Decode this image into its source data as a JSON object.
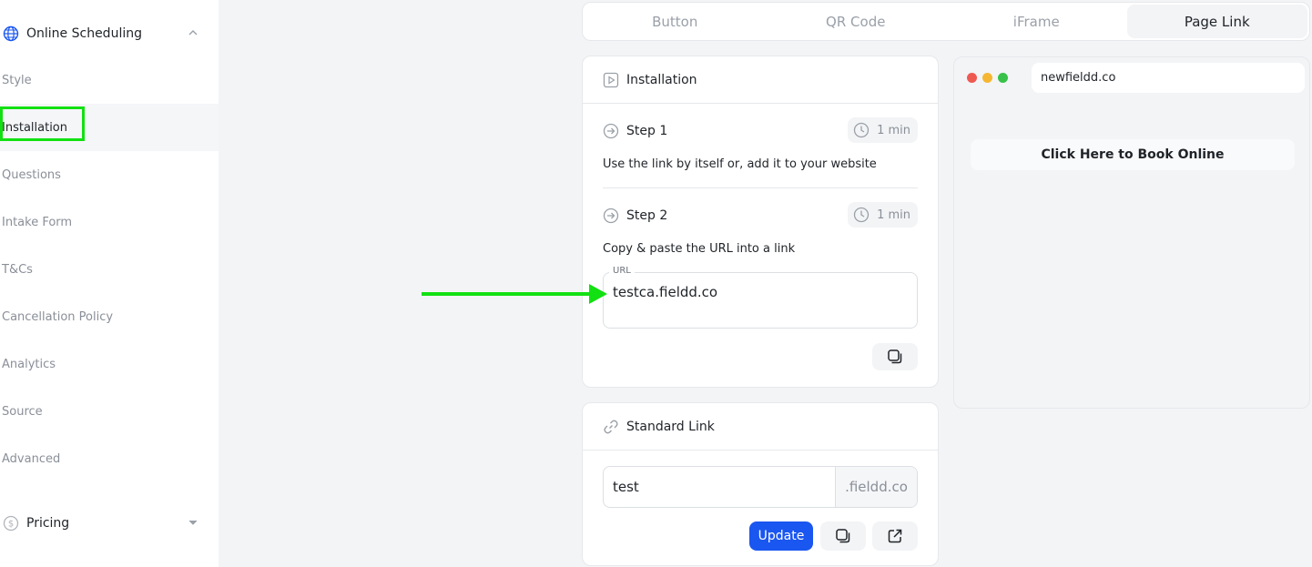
{
  "sidebar": {
    "online_scheduling": "Online Scheduling",
    "items": [
      {
        "label": "Style"
      },
      {
        "label": "Installation"
      },
      {
        "label": "Questions"
      },
      {
        "label": "Intake Form"
      },
      {
        "label": "T&Cs"
      },
      {
        "label": "Cancellation Policy"
      },
      {
        "label": "Analytics"
      },
      {
        "label": "Source"
      },
      {
        "label": "Advanced"
      }
    ],
    "pricing": "Pricing"
  },
  "tabs": [
    "Button",
    "QR Code",
    "iFrame",
    "Page Link"
  ],
  "installation": {
    "title": "Installation",
    "step1": {
      "title": "Step 1",
      "time": "1 min",
      "desc": "Use the link by itself or, add it to your website"
    },
    "step2": {
      "title": "Step 2",
      "time": "1 min",
      "desc": "Copy & paste the URL into a link"
    },
    "url_label": "URL",
    "url_value": "testca.fieldd.co"
  },
  "standard_link": {
    "title": "Standard Link",
    "value": "test",
    "suffix": ".fieldd.co",
    "update_label": "Update"
  },
  "preview": {
    "address": "newfieldd.co",
    "book_label": "Click Here to Book Online"
  },
  "colors": {
    "accent": "#1a56f0",
    "highlight": "#12e012",
    "dot_red": "#ee5a52",
    "dot_yellow": "#f5b731",
    "dot_green": "#38c149"
  }
}
